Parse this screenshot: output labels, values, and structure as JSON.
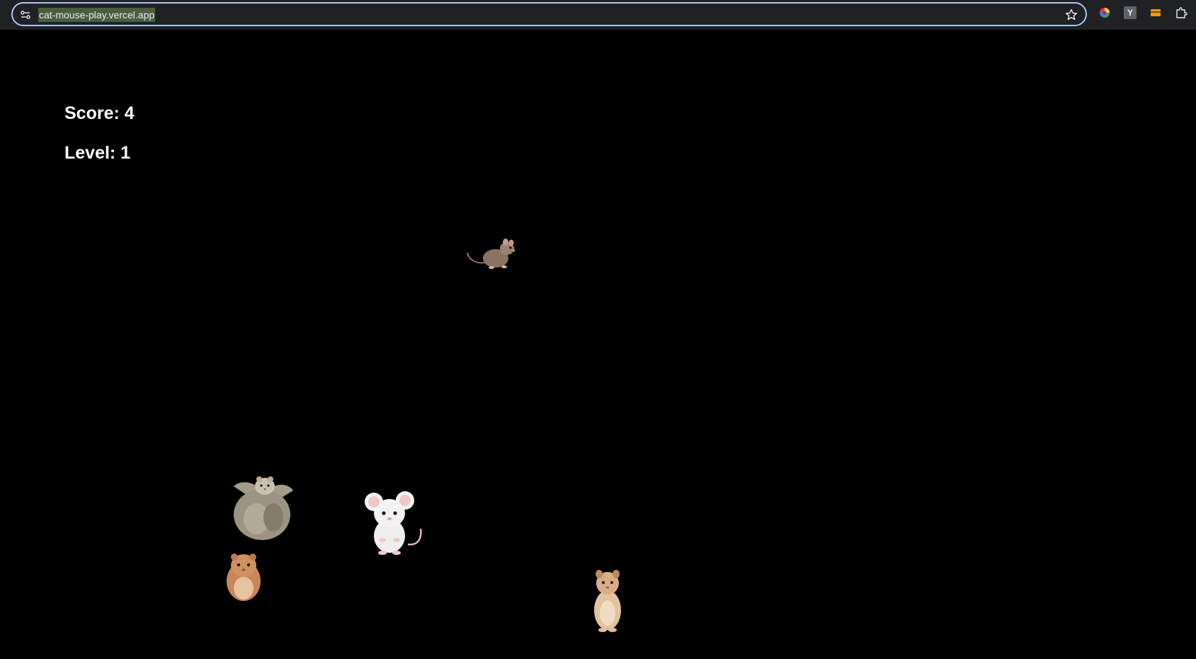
{
  "browser": {
    "url": "cat-mouse-play.vercel.app",
    "extensions": [
      "color-wheel-icon",
      "y-extension-icon",
      "orange-card-icon",
      "puzzle-piece-icon"
    ],
    "y_ext_letter": "Y"
  },
  "game": {
    "score_text": "Score: 4",
    "level_text": "Level: 1",
    "critters": [
      {
        "name": "brown-mouse-sprite",
        "kind": "mouse"
      },
      {
        "name": "fluffy-hamster-sprite",
        "kind": "hamster"
      },
      {
        "name": "white-mouse-sprite",
        "kind": "mouse"
      },
      {
        "name": "orange-hamster-sprite",
        "kind": "hamster"
      },
      {
        "name": "standing-hamster-sprite",
        "kind": "hamster"
      }
    ]
  },
  "colors": {
    "background": "#000000",
    "hud_text": "#ffffff",
    "omnibox_border": "#a8c7fa"
  }
}
